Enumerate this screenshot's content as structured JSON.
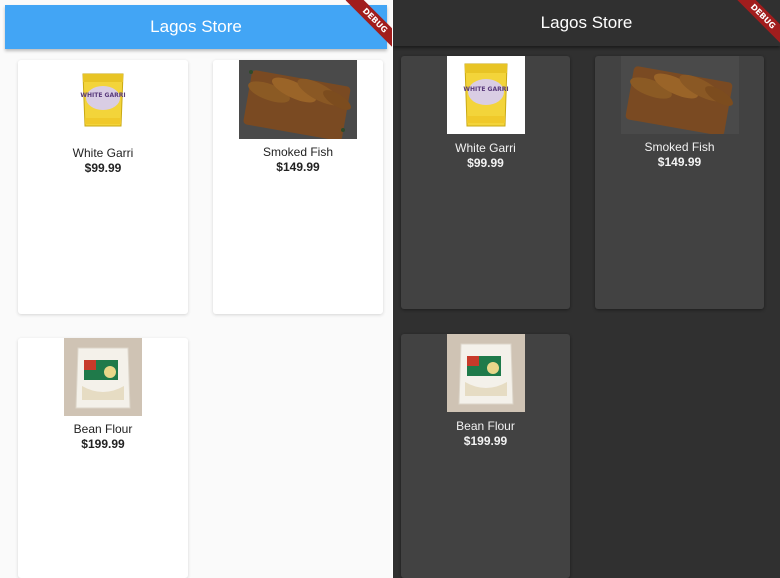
{
  "app": {
    "title": "Lagos Store",
    "debug_label": "DEBUG"
  },
  "colors": {
    "appbar_light": "#42a5f5",
    "background_light": "#fafafa",
    "background_dark": "#303030",
    "card_dark": "#424242",
    "debug_banner": "#a11d1d"
  },
  "products": [
    {
      "name": "White Garri",
      "price": "$99.99",
      "icon": "garri-bag-image"
    },
    {
      "name": "Smoked Fish",
      "price": "$149.99",
      "icon": "smoked-fish-image"
    },
    {
      "name": "Bean Flour",
      "price": "$199.99",
      "icon": "bean-flour-bag-image"
    }
  ],
  "package_label": "WHITE GARRI"
}
